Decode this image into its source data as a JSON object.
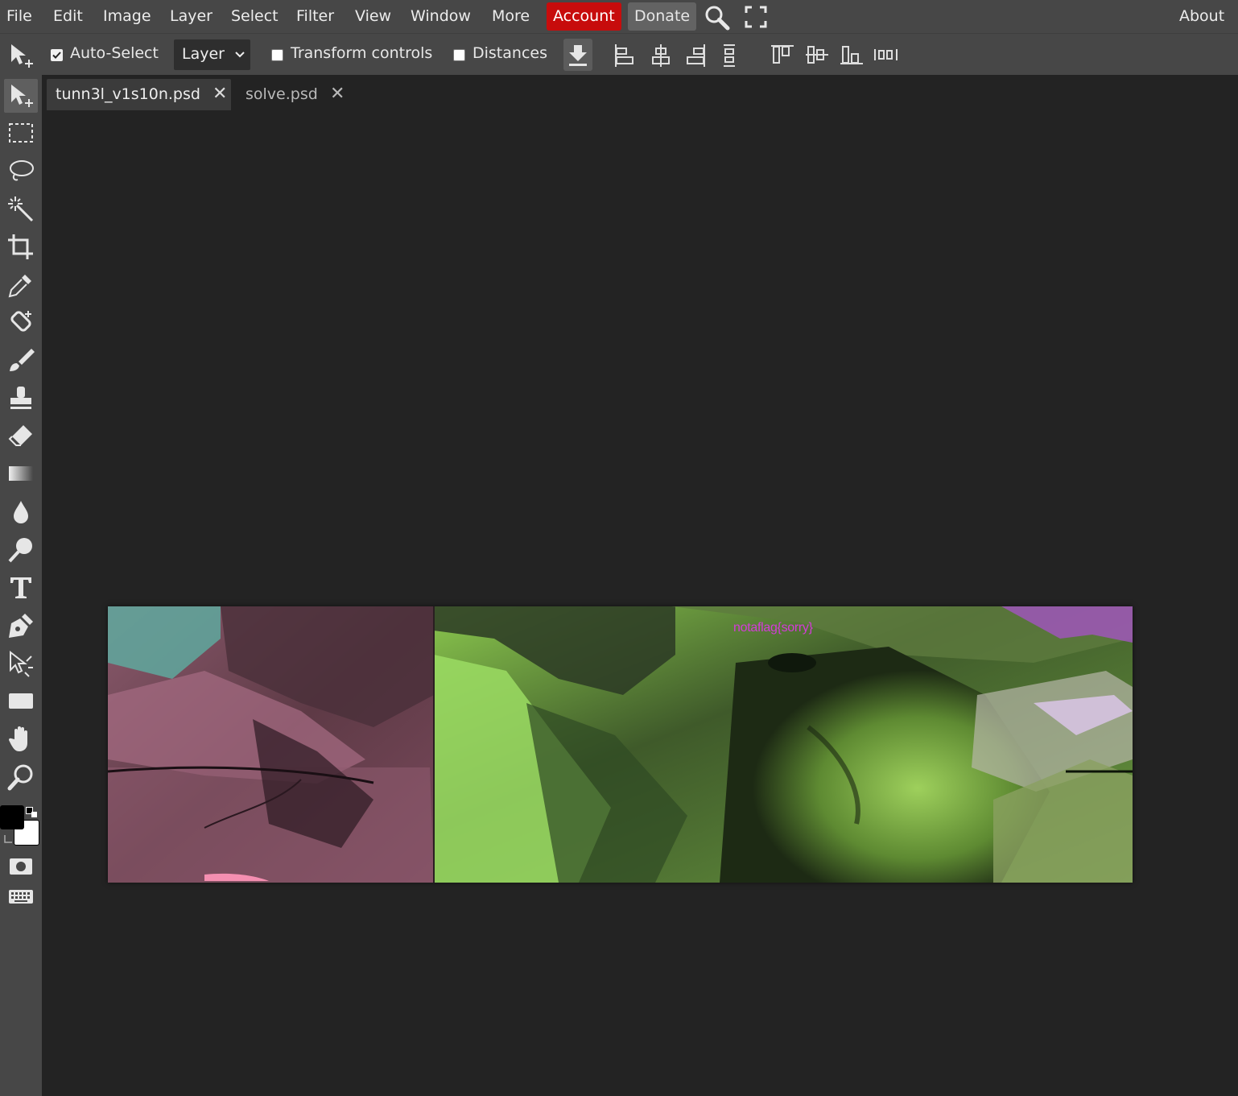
{
  "menu": {
    "items": [
      "File",
      "Edit",
      "Image",
      "Layer",
      "Select",
      "Filter",
      "View",
      "Window",
      "More"
    ],
    "account_label": "Account",
    "donate_label": "Donate",
    "about_label": "About"
  },
  "options": {
    "auto_select_label": "Auto-Select",
    "auto_select_checked": true,
    "layer_select_value": "Layer",
    "transform_controls_label": "Transform controls",
    "transform_controls_checked": false,
    "distances_label": "Distances",
    "distances_checked": false
  },
  "tabs": [
    {
      "label": "tunn3l_v1s10n.psd",
      "active": true
    },
    {
      "label": "solve.psd",
      "active": false
    }
  ],
  "canvas": {
    "overlay_text": "notaflag{sorry}"
  },
  "colors": {
    "foreground": "#000000",
    "background": "#ffffff",
    "account_bg": "#c70c0c"
  },
  "tools": [
    "move-icon",
    "marquee-icon",
    "lasso-icon",
    "magic-wand-icon",
    "crop-icon",
    "eyedropper-icon",
    "healing-icon",
    "brush-icon",
    "stamp-icon",
    "eraser-icon",
    "gradient-icon",
    "blur-icon",
    "dodge-icon",
    "text-icon",
    "pen-icon",
    "path-select-icon",
    "rectangle-icon",
    "hand-icon",
    "zoom-icon"
  ]
}
